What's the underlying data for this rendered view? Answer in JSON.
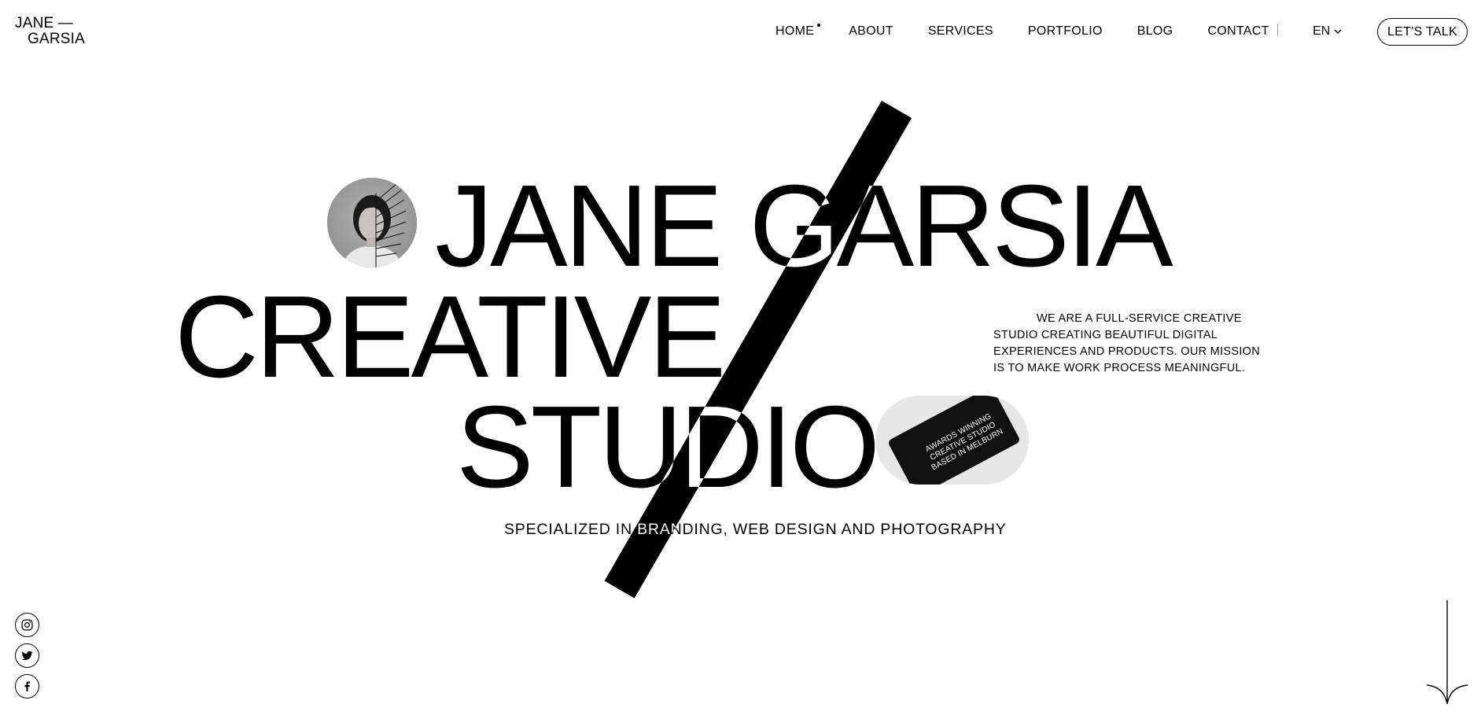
{
  "logo": {
    "line1": "JANE —",
    "line2": "GARSIA"
  },
  "nav": {
    "items": [
      {
        "label": "HOME",
        "active": true
      },
      {
        "label": "ABOUT"
      },
      {
        "label": "SERVICES"
      },
      {
        "label": "PORTFOLIO"
      },
      {
        "label": "BLOG"
      },
      {
        "label": "CONTACT"
      }
    ],
    "lang": "EN",
    "cta": "LET'S TALK"
  },
  "hero": {
    "line1": "JANE GARSIA",
    "line2": "CREATIVE",
    "line3": "STUDIO",
    "card_text": [
      "AWARDS WINNING",
      "CREATIVE STUDIO",
      "BASED IN MELBURN"
    ],
    "intro": "WE ARE A FULL-SERVICE CREATIVE STUDIO CREATING BEAUTIFUL DIGITAL EXPERIENCES AND PRODUCTS. OUR MISSION IS TO MAKE WORK PROCESS MEANINGFUL.",
    "tagline": "SPECIALIZED IN BRANDING, WEB DESIGN AND PHOTOGRAPHY"
  },
  "social": [
    {
      "icon": "instagram-icon"
    },
    {
      "icon": "twitter-icon"
    },
    {
      "icon": "facebook-icon"
    }
  ],
  "colors": {
    "foreground": "#000000",
    "background": "#ffffff"
  }
}
